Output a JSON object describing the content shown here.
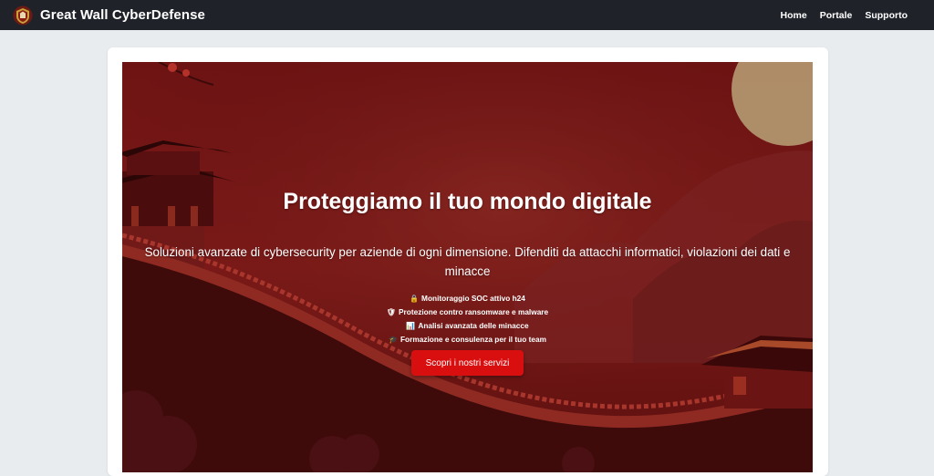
{
  "navbar": {
    "brand": "Great Wall CyberDefense",
    "links": [
      {
        "label": "Home"
      },
      {
        "label": "Portale"
      },
      {
        "label": "Supporto"
      }
    ]
  },
  "hero": {
    "title": "Proteggiamo il tuo mondo digitale",
    "subtitle": "Soluzioni avanzate di cybersecurity per aziende di ogni dimensione. Difenditi da attacchi informatici, violazioni dei dati e minacce",
    "features": [
      {
        "icon": "lock-icon",
        "glyph": "🔒",
        "text": "Monitoraggio SOC attivo h24"
      },
      {
        "icon": "shield-icon",
        "glyph": "🛡",
        "text": "Protezione contro ransomware e malware"
      },
      {
        "icon": "chart-icon",
        "glyph": "📊",
        "text": "Analisi avanzata delle minacce"
      },
      {
        "icon": "graduation-icon",
        "glyph": "🎓",
        "text": "Formazione e consulenza per il tuo team"
      }
    ],
    "cta": "Scopri i nostri servizi"
  },
  "colors": {
    "navbar": "#1f2329",
    "page_background": "#e9ecef",
    "hero_red": "#7a1414",
    "cta": "#d90e0e"
  }
}
